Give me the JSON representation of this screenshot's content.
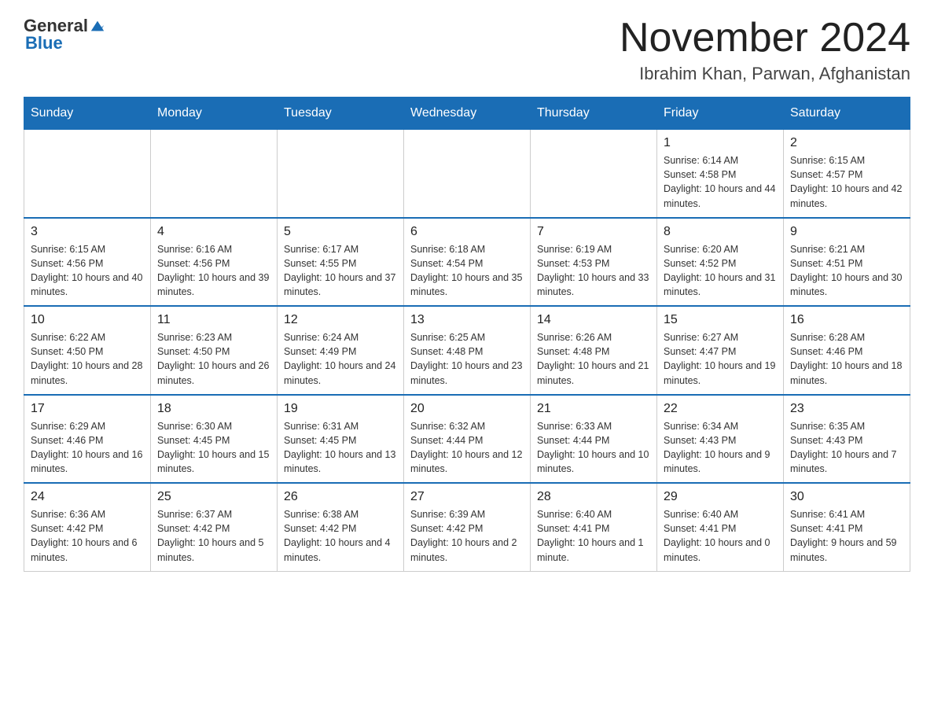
{
  "header": {
    "logo_general": "General",
    "logo_blue": "Blue",
    "month_title": "November 2024",
    "location": "Ibrahim Khan, Parwan, Afghanistan"
  },
  "weekdays": [
    "Sunday",
    "Monday",
    "Tuesday",
    "Wednesday",
    "Thursday",
    "Friday",
    "Saturday"
  ],
  "weeks": [
    [
      {
        "day": "",
        "info": ""
      },
      {
        "day": "",
        "info": ""
      },
      {
        "day": "",
        "info": ""
      },
      {
        "day": "",
        "info": ""
      },
      {
        "day": "",
        "info": ""
      },
      {
        "day": "1",
        "info": "Sunrise: 6:14 AM\nSunset: 4:58 PM\nDaylight: 10 hours and 44 minutes."
      },
      {
        "day": "2",
        "info": "Sunrise: 6:15 AM\nSunset: 4:57 PM\nDaylight: 10 hours and 42 minutes."
      }
    ],
    [
      {
        "day": "3",
        "info": "Sunrise: 6:15 AM\nSunset: 4:56 PM\nDaylight: 10 hours and 40 minutes."
      },
      {
        "day": "4",
        "info": "Sunrise: 6:16 AM\nSunset: 4:56 PM\nDaylight: 10 hours and 39 minutes."
      },
      {
        "day": "5",
        "info": "Sunrise: 6:17 AM\nSunset: 4:55 PM\nDaylight: 10 hours and 37 minutes."
      },
      {
        "day": "6",
        "info": "Sunrise: 6:18 AM\nSunset: 4:54 PM\nDaylight: 10 hours and 35 minutes."
      },
      {
        "day": "7",
        "info": "Sunrise: 6:19 AM\nSunset: 4:53 PM\nDaylight: 10 hours and 33 minutes."
      },
      {
        "day": "8",
        "info": "Sunrise: 6:20 AM\nSunset: 4:52 PM\nDaylight: 10 hours and 31 minutes."
      },
      {
        "day": "9",
        "info": "Sunrise: 6:21 AM\nSunset: 4:51 PM\nDaylight: 10 hours and 30 minutes."
      }
    ],
    [
      {
        "day": "10",
        "info": "Sunrise: 6:22 AM\nSunset: 4:50 PM\nDaylight: 10 hours and 28 minutes."
      },
      {
        "day": "11",
        "info": "Sunrise: 6:23 AM\nSunset: 4:50 PM\nDaylight: 10 hours and 26 minutes."
      },
      {
        "day": "12",
        "info": "Sunrise: 6:24 AM\nSunset: 4:49 PM\nDaylight: 10 hours and 24 minutes."
      },
      {
        "day": "13",
        "info": "Sunrise: 6:25 AM\nSunset: 4:48 PM\nDaylight: 10 hours and 23 minutes."
      },
      {
        "day": "14",
        "info": "Sunrise: 6:26 AM\nSunset: 4:48 PM\nDaylight: 10 hours and 21 minutes."
      },
      {
        "day": "15",
        "info": "Sunrise: 6:27 AM\nSunset: 4:47 PM\nDaylight: 10 hours and 19 minutes."
      },
      {
        "day": "16",
        "info": "Sunrise: 6:28 AM\nSunset: 4:46 PM\nDaylight: 10 hours and 18 minutes."
      }
    ],
    [
      {
        "day": "17",
        "info": "Sunrise: 6:29 AM\nSunset: 4:46 PM\nDaylight: 10 hours and 16 minutes."
      },
      {
        "day": "18",
        "info": "Sunrise: 6:30 AM\nSunset: 4:45 PM\nDaylight: 10 hours and 15 minutes."
      },
      {
        "day": "19",
        "info": "Sunrise: 6:31 AM\nSunset: 4:45 PM\nDaylight: 10 hours and 13 minutes."
      },
      {
        "day": "20",
        "info": "Sunrise: 6:32 AM\nSunset: 4:44 PM\nDaylight: 10 hours and 12 minutes."
      },
      {
        "day": "21",
        "info": "Sunrise: 6:33 AM\nSunset: 4:44 PM\nDaylight: 10 hours and 10 minutes."
      },
      {
        "day": "22",
        "info": "Sunrise: 6:34 AM\nSunset: 4:43 PM\nDaylight: 10 hours and 9 minutes."
      },
      {
        "day": "23",
        "info": "Sunrise: 6:35 AM\nSunset: 4:43 PM\nDaylight: 10 hours and 7 minutes."
      }
    ],
    [
      {
        "day": "24",
        "info": "Sunrise: 6:36 AM\nSunset: 4:42 PM\nDaylight: 10 hours and 6 minutes."
      },
      {
        "day": "25",
        "info": "Sunrise: 6:37 AM\nSunset: 4:42 PM\nDaylight: 10 hours and 5 minutes."
      },
      {
        "day": "26",
        "info": "Sunrise: 6:38 AM\nSunset: 4:42 PM\nDaylight: 10 hours and 4 minutes."
      },
      {
        "day": "27",
        "info": "Sunrise: 6:39 AM\nSunset: 4:42 PM\nDaylight: 10 hours and 2 minutes."
      },
      {
        "day": "28",
        "info": "Sunrise: 6:40 AM\nSunset: 4:41 PM\nDaylight: 10 hours and 1 minute."
      },
      {
        "day": "29",
        "info": "Sunrise: 6:40 AM\nSunset: 4:41 PM\nDaylight: 10 hours and 0 minutes."
      },
      {
        "day": "30",
        "info": "Sunrise: 6:41 AM\nSunset: 4:41 PM\nDaylight: 9 hours and 59 minutes."
      }
    ]
  ]
}
